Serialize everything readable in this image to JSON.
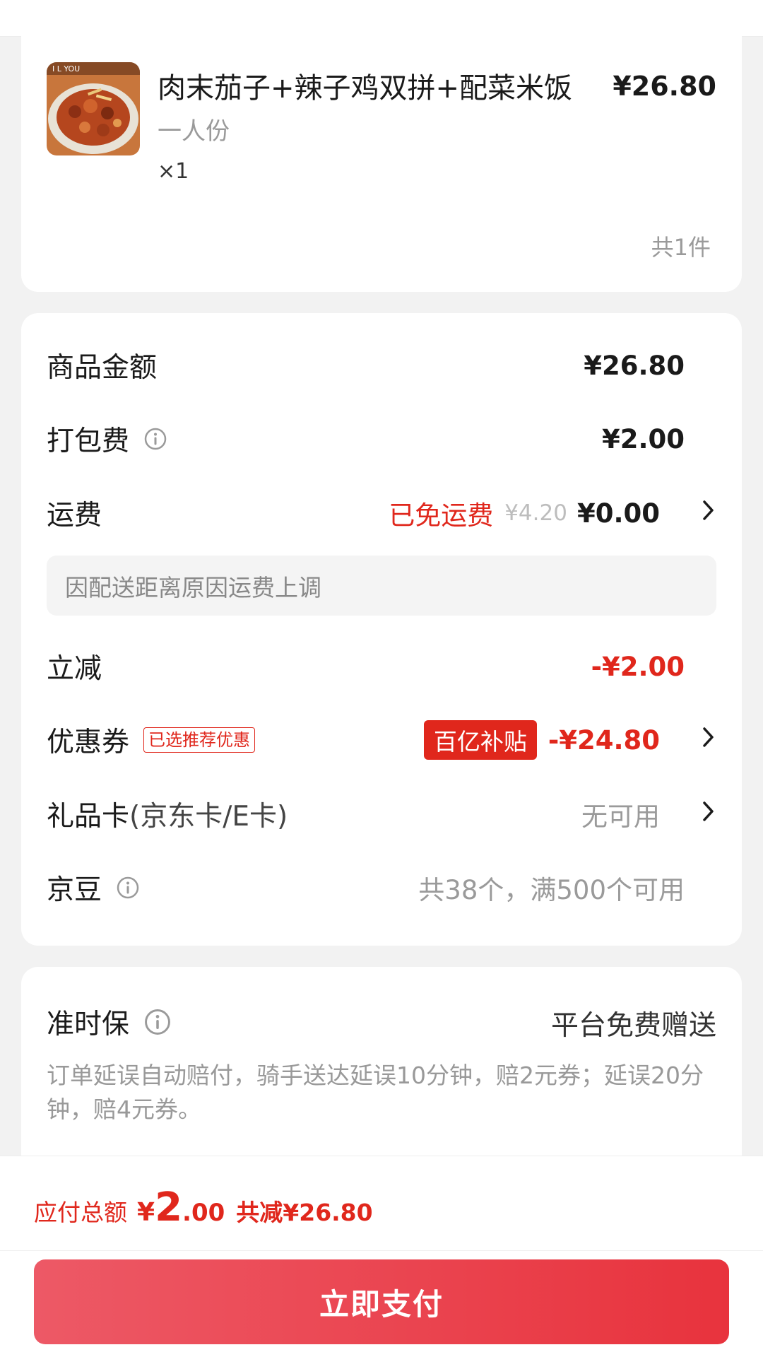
{
  "product": {
    "name": "肉末茄子+辣子鸡双拼+配菜米饭",
    "spec": "一人份",
    "qty": "×1",
    "price": "¥26.80",
    "count": "共1件",
    "thumb_text": "I L YOU"
  },
  "fees": {
    "goods_label": "商品金额",
    "goods_value": "¥26.80",
    "pack_label": "打包费",
    "pack_value": "¥2.00",
    "ship_label": "运费",
    "ship_free_tag": "已免运费",
    "ship_original": "¥4.20",
    "ship_value": "¥0.00",
    "ship_note": "因配送距离原因运费上调",
    "discount_label": "立减",
    "discount_value": "-¥2.00",
    "coupon_label": "优惠券",
    "coupon_tag": "已选推荐优惠",
    "coupon_badge": "百亿补贴",
    "coupon_value": "-¥24.80",
    "gift_label": "礼品卡",
    "gift_sub": "(京东卡/E卡)",
    "gift_value": "无可用",
    "beans_label": "京豆",
    "beans_value": "共38个，满500个可用"
  },
  "ontime": {
    "title": "准时保",
    "right": "平台免费赠送",
    "desc": "订单延误自动赔付，骑手送达延误10分钟，赔2元券；延误20分钟，赔4元券。"
  },
  "footer": {
    "total_label": "应付总额",
    "total_yen": "¥",
    "total_int": "2",
    "total_dec": ".00",
    "total_cut": "共减¥26.80",
    "pay_label": "立即支付"
  },
  "colors": {
    "accent": "#e0271c",
    "pay_gradient_start": "#ed5966",
    "pay_gradient_end": "#e8333d"
  },
  "icons": [
    "info-icon",
    "chevron-right-icon"
  ]
}
